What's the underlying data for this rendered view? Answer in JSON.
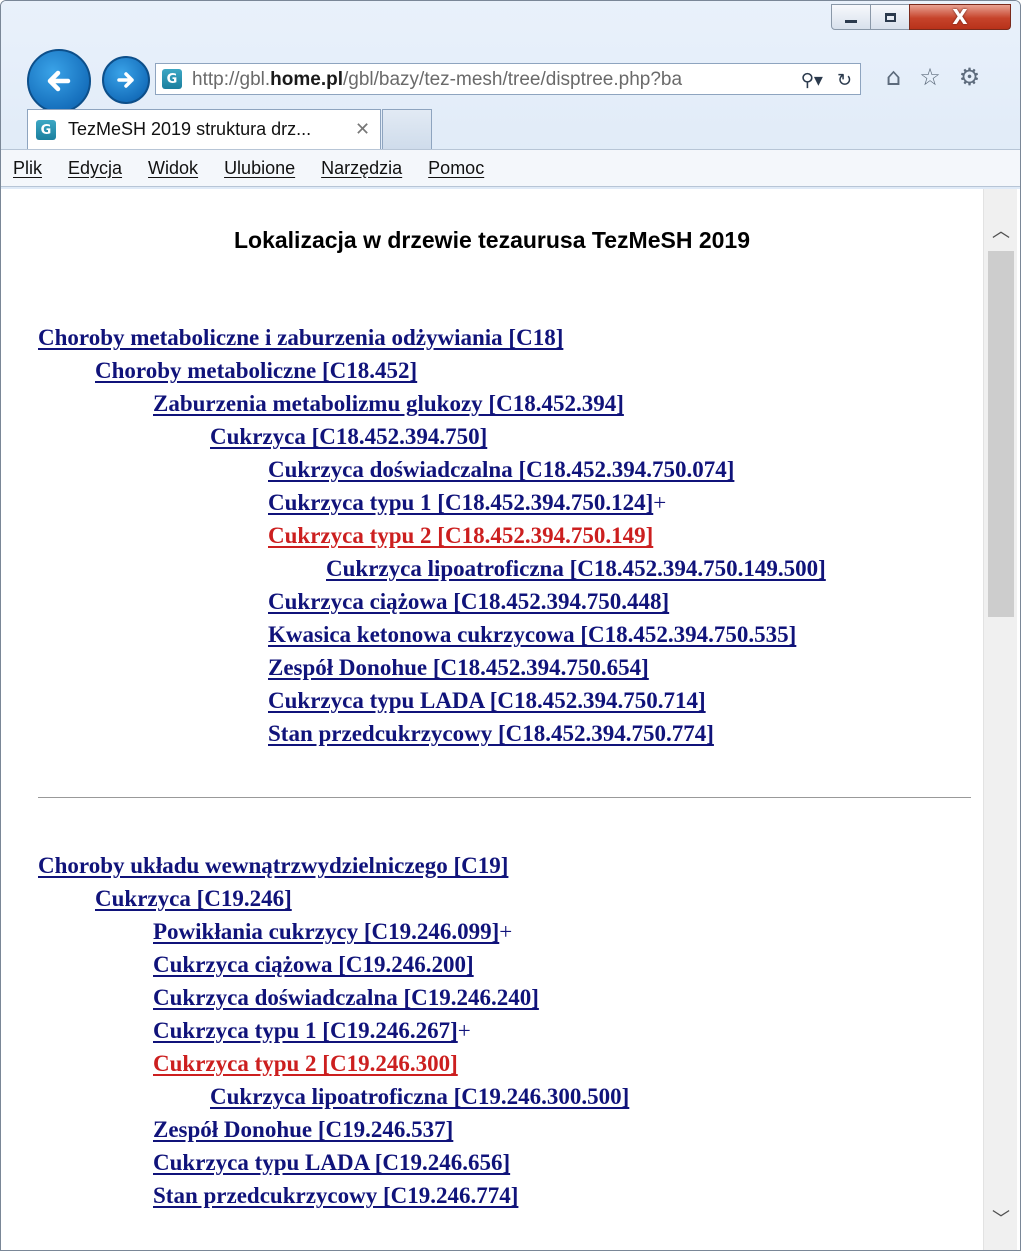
{
  "window": {
    "caption_close": "X"
  },
  "address_bar": {
    "url_prefix": "http://gbl.",
    "url_host": "home.pl",
    "url_rest": "/gbl/bazy/tez-mesh/tree/disptree.php?ba",
    "search_icon": "search-icon",
    "refresh_icon": "refresh-icon"
  },
  "tab": {
    "title": "TezMeSH 2019 struktura drz...",
    "close": "✕"
  },
  "menu": {
    "items": [
      "Plik",
      "Edycja",
      "Widok",
      "Ulubione",
      "Narzędzia",
      "Pomoc"
    ]
  },
  "page": {
    "title": "Lokalizacja w drzewie tezaurusa TezMeSH 2019"
  },
  "tree1": [
    {
      "label": "Choroby metaboliczne i zaburzenia odżywiania [C18]",
      "level": 0,
      "current": false,
      "plus": ""
    },
    {
      "label": "Choroby metaboliczne [C18.452]",
      "level": 1,
      "current": false,
      "plus": ""
    },
    {
      "label": "Zaburzenia metabolizmu glukozy [C18.452.394]",
      "level": 2,
      "current": false,
      "plus": ""
    },
    {
      "label": "Cukrzyca [C18.452.394.750]",
      "level": 3,
      "current": false,
      "plus": ""
    },
    {
      "label": "Cukrzyca doświadczalna [C18.452.394.750.074]",
      "level": 4,
      "current": false,
      "plus": ""
    },
    {
      "label": "Cukrzyca typu 1 [C18.452.394.750.124]",
      "level": 4,
      "current": false,
      "plus": "+"
    },
    {
      "label": "Cukrzyca typu 2 [C18.452.394.750.149]",
      "level": 4,
      "current": true,
      "plus": ""
    },
    {
      "label": "Cukrzyca lipoatroficzna [C18.452.394.750.149.500]",
      "level": 5,
      "current": false,
      "plus": ""
    },
    {
      "label": "Cukrzyca ciążowa [C18.452.394.750.448]",
      "level": 4,
      "current": false,
      "plus": ""
    },
    {
      "label": "Kwasica ketonowa cukrzycowa [C18.452.394.750.535]",
      "level": 4,
      "current": false,
      "plus": ""
    },
    {
      "label": "Zespół Donohue [C18.452.394.750.654]",
      "level": 4,
      "current": false,
      "plus": ""
    },
    {
      "label": "Cukrzyca typu LADA [C18.452.394.750.714]",
      "level": 4,
      "current": false,
      "plus": ""
    },
    {
      "label": "Stan przedcukrzycowy [C18.452.394.750.774]",
      "level": 4,
      "current": false,
      "plus": ""
    }
  ],
  "tree2": [
    {
      "label": "Choroby układu wewnątrzwydzielniczego [C19]",
      "level": 0,
      "current": false,
      "plus": ""
    },
    {
      "label": "Cukrzyca [C19.246]",
      "level": 1,
      "current": false,
      "plus": ""
    },
    {
      "label": "Powikłania cukrzycy [C19.246.099]",
      "level": 2,
      "current": false,
      "plus": "+"
    },
    {
      "label": "Cukrzyca ciążowa [C19.246.200]",
      "level": 2,
      "current": false,
      "plus": ""
    },
    {
      "label": "Cukrzyca doświadczalna [C19.246.240]",
      "level": 2,
      "current": false,
      "plus": ""
    },
    {
      "label": "Cukrzyca typu 1 [C19.246.267]",
      "level": 2,
      "current": false,
      "plus": "+"
    },
    {
      "label": "Cukrzyca typu 2 [C19.246.300]",
      "level": 2,
      "current": true,
      "plus": ""
    },
    {
      "label": "Cukrzyca lipoatroficzna [C19.246.300.500]",
      "level": 3,
      "current": false,
      "plus": ""
    },
    {
      "label": "Zespół Donohue [C19.246.537]",
      "level": 2,
      "current": false,
      "plus": ""
    },
    {
      "label": "Cukrzyca typu LADA [C19.246.656]",
      "level": 2,
      "current": false,
      "plus": ""
    },
    {
      "label": "Stan przedcukrzycowy [C19.246.774]",
      "level": 2,
      "current": false,
      "plus": ""
    }
  ],
  "colors": {
    "link": "#10137a",
    "current_link": "#cc1f1f"
  }
}
